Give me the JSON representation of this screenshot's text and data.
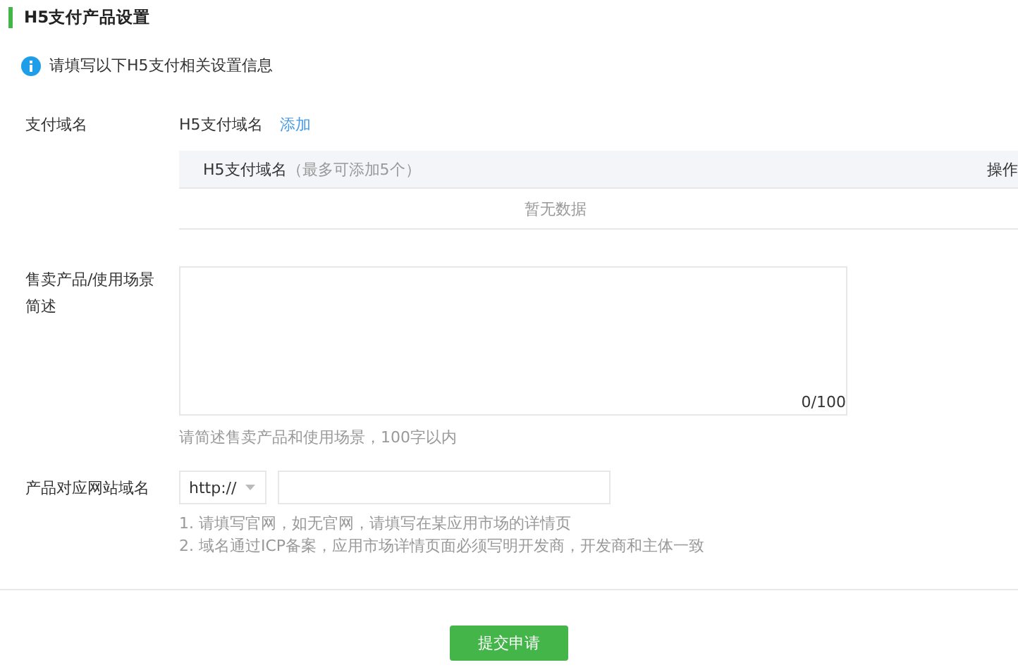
{
  "section": {
    "title": "H5支付产品设置"
  },
  "notice": {
    "text": "请填写以下H5支付相关设置信息"
  },
  "pay_domain": {
    "label": "支付域名",
    "field_name": "H5支付域名",
    "add_link": "添加",
    "table": {
      "columns": [
        {
          "title": "H5支付域名",
          "note": "（最多可添加5个）"
        },
        {
          "title": "操作"
        }
      ],
      "empty_text": "暂无数据"
    }
  },
  "description": {
    "label": "售卖产品/使用场景简述",
    "counter": "0/100",
    "hint": "请简述售卖产品和使用场景，100字以内"
  },
  "website": {
    "label": "产品对应网站域名",
    "protocol": "http://",
    "notes": [
      "1. 请填写官网，如无官网，请填写在某应用市场的详情页",
      "2. 域名通过ICP备案，应用市场详情页面必须写明开发商，开发商和主体一致"
    ]
  },
  "submit_button": "提交申请"
}
